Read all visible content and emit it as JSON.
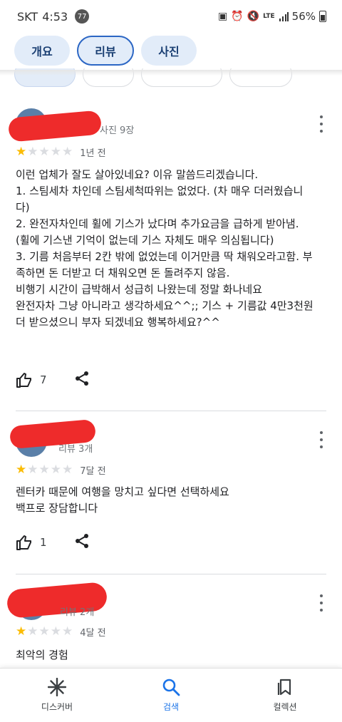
{
  "status_bar": {
    "carrier": "SKT",
    "time": "4:53",
    "badge": "77",
    "battery": "56%",
    "network": "LTE"
  },
  "tabs": [
    {
      "label": "개요"
    },
    {
      "label": "리뷰"
    },
    {
      "label": "사진"
    }
  ],
  "reviews": [
    {
      "meta": "사진 9장",
      "rating": 1,
      "time": "1년 전",
      "text": "이런 업체가 잘도 살아있네요? 이유 말씀드리겠습니다.\n1. 스팀세차 차인데 스팀세척따위는 없었다. (차 매우 더러웠습니다)\n2. 완전자차인데 휠에 기스가 났다며 추가요금을 급하게 받아냄. (휠에 기스낸 기억이 없는데 기스 자체도 매우 의심됩니다)\n3. 기름 처음부터 2칸 밖에 없었는데 이거만큼 딱 채워오라고함. 부족하면 돈 더받고 더 채워오면 돈 돌려주지 않음.\n비행기 시간이 급박해서 성급히 나왔는데 정말 화나네요\n완전자차 그냥 아니라고 생각하세요^^;; 기스 + 기름값 4만3천원 더 받으셨으니 부자 되겠네요 행복하세요?^^",
      "likes": "7"
    },
    {
      "meta": "리뷰 3개",
      "rating": 1,
      "time": "7달 전",
      "text": "렌터카 때문에 여행을 망치고 싶다면 선택하세요\n백프로 장담합니다",
      "likes": "1"
    },
    {
      "meta": "리뷰 2개",
      "rating": 1,
      "time": "4달 전",
      "text": "최악의 경험",
      "likes": ""
    }
  ],
  "bottom_nav": [
    {
      "label": "디스커버",
      "icon": "asterisk-icon"
    },
    {
      "label": "검색",
      "icon": "search-icon"
    },
    {
      "label": "컬렉션",
      "icon": "bookmark-icon"
    }
  ],
  "colors": {
    "accent": "#1a73e8",
    "star": "#fbbc04",
    "tab_bg": "#e2ecf9",
    "tab_border": "#2b66c4"
  }
}
